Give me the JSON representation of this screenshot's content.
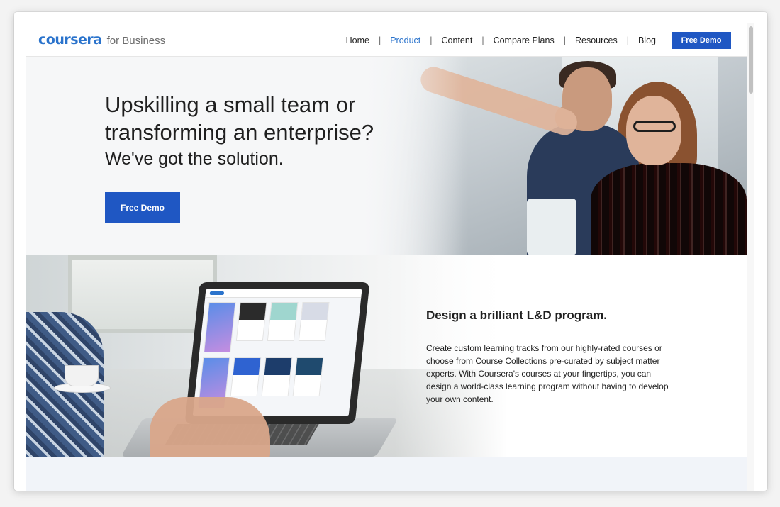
{
  "header": {
    "logo_word": "coursera",
    "logo_suffix": "for Business",
    "nav": {
      "home": "Home",
      "product": "Product",
      "content": "Content",
      "compare_plans": "Compare Plans",
      "resources": "Resources",
      "blog": "Blog",
      "separator": "|"
    },
    "demo_button": "Free Demo"
  },
  "hero": {
    "title": "Upskilling a small team or transforming an enterprise?",
    "subtitle": "We've got the solution.",
    "demo_button": "Free Demo"
  },
  "feature": {
    "title": "Design a brilliant L&D program.",
    "body": "Create custom learning tracks from our highly-rated courses or choose from Course Collections pre-curated by subject matter experts. With Coursera's courses at your fingertips, you can design a world-class learning program without having to develop your own content."
  },
  "colors": {
    "brand_blue": "#2a73cc",
    "button_blue": "#1f57c3",
    "text": "#1f1f1f"
  },
  "scroll": {
    "position_fraction": 0.0
  }
}
